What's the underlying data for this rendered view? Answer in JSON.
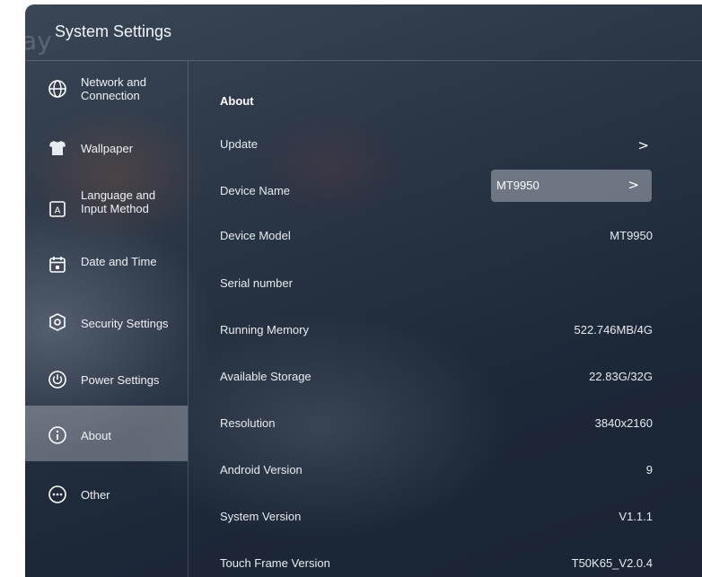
{
  "header": {
    "title": "System Settings",
    "watermark": "ay"
  },
  "sidebar": {
    "items": [
      {
        "label": "Network and\nConnection",
        "icon": "globe-icon"
      },
      {
        "label": "Wallpaper",
        "icon": "shirt-icon"
      },
      {
        "label": "Language and\nInput Method",
        "icon": "keyboard-letter-icon"
      },
      {
        "label": "Date and Time",
        "icon": "calendar-icon"
      },
      {
        "label": "Security Settings",
        "icon": "shield-icon"
      },
      {
        "label": "Power Settings",
        "icon": "power-icon"
      },
      {
        "label": "About",
        "icon": "info-icon",
        "active": true
      },
      {
        "label": "Other",
        "icon": "more-icon"
      }
    ]
  },
  "main": {
    "section_title": "About",
    "rows": [
      {
        "label": "Update",
        "value": "",
        "chevron": ">"
      },
      {
        "label": "Device Name",
        "value": "MT9950",
        "chevron": ">"
      },
      {
        "label": "Device Model",
        "value": "MT9950"
      },
      {
        "label": "Serial number",
        "value": ""
      },
      {
        "label": "Running Memory",
        "value": "522.746MB/4G"
      },
      {
        "label": "Available Storage",
        "value": "22.83G/32G"
      },
      {
        "label": "Resolution",
        "value": "3840x2160"
      },
      {
        "label": "Android Version",
        "value": "9"
      },
      {
        "label": "System Version",
        "value": "V1.1.1"
      },
      {
        "label": "Touch Frame Version",
        "value": "T50K65_V2.0.4"
      }
    ]
  },
  "colors": {
    "background": "#26313f",
    "active_item": "#9ca2ab",
    "text": "#ffffff"
  }
}
